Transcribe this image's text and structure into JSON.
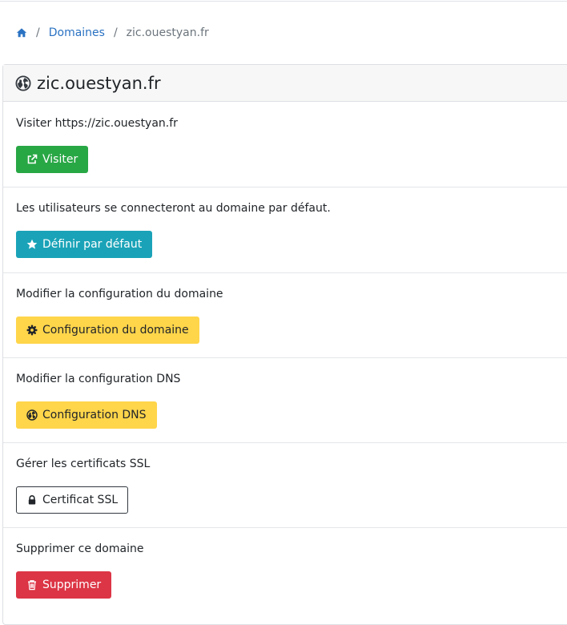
{
  "breadcrumb": {
    "home_icon": "home-icon",
    "separator": "/",
    "domains_label": "Domaines",
    "current": "zic.ouestyan.fr"
  },
  "card": {
    "icon": "globe-icon",
    "title": "zic.ouestyan.fr"
  },
  "sections": {
    "visit": {
      "description": "Visiter https://zic.ouestyan.fr",
      "button_label": "Visiter",
      "button_icon": "external-link-icon"
    },
    "default": {
      "description": "Les utilisateurs se connecteront au domaine par défaut.",
      "button_label": "Définir par défaut",
      "button_icon": "star-icon"
    },
    "domain_config": {
      "description": "Modifier la configuration du domaine",
      "button_label": "Configuration du domaine",
      "button_icon": "gear-icon"
    },
    "dns_config": {
      "description": "Modifier la configuration DNS",
      "button_label": "Configuration DNS",
      "button_icon": "globe-icon"
    },
    "ssl": {
      "description": "Gérer les certificats SSL",
      "button_label": "Certificat SSL",
      "button_icon": "lock-icon"
    },
    "delete": {
      "description": "Supprimer ce domaine",
      "button_label": "Supprimer",
      "button_icon": "trash-icon"
    }
  },
  "colors": {
    "link": "#2a72c2",
    "success": "#28a745",
    "info": "#1aa3b8",
    "warning": "#ffd54a",
    "danger": "#dc3545"
  }
}
